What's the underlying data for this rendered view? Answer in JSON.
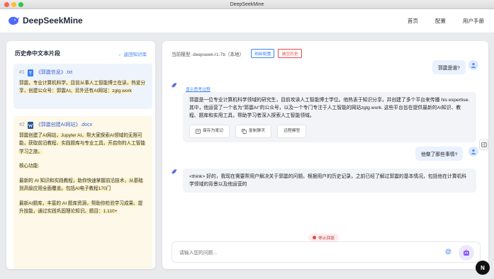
{
  "window": {
    "title": "DeepSeekMine"
  },
  "nav": {
    "brand": "DeepSeekMine",
    "links": [
      "首页",
      "配置",
      "用户手册"
    ]
  },
  "left": {
    "title": "历史命中文本片段",
    "back_label": "← 返回知识库",
    "fragments": [
      {
        "num": "#1",
        "name": "《郭震信息》.txt",
        "icon": "txt-file-icon",
        "paragraphs": [
          "郭震，专业计算机科学，目前从事人工智能博士在读，热爱分享，创建公众号：郭震AI。另外还有AI网站：zglg.work"
        ]
      },
      {
        "num": "#2",
        "name": "《郭震创建AI网站》.docx",
        "icon": "word-file-icon",
        "paragraphs": [
          "郭震创建了AI网站，Jupyter AI，帮大家探索AI领域的无限可能，获取前沿教程、实践题库与专业工具，开启你的人工智能学习之旅。",
          "核心功能:",
          "最新的 AI 知识和实践教程，助你快速掌握前沿技术，从基础到高级应用全面覆盖。包括AI电子教程170门",
          "最新AI题库，丰富的 AI 题库资源，帮助你检验学习成果、提升技能，通过实践巩固理论知识。题目：1,110+"
        ]
      }
    ]
  },
  "chat": {
    "model_label": "当前模型: deepseek-r1:7b（本地）",
    "refresh_label": "刷新配置",
    "clear_label": "清空历史",
    "messages": [
      {
        "role": "user",
        "text": "郭震是谁?"
      },
      {
        "role": "ai",
        "think_link": "显示思考过程",
        "text": "郭震是一位专业计算机科学领域的研究生，目前攻读人工智能博士学位。他热衷于知识分享，并创建了多个平台来传播 his expertise. 其中，他运营了一个名为\"郭震AI\"的公众号，以及一个专门专注于人工智能的网站zglg.work. 这些平台旨在提供最新的AI知识、教程、题库和实用工具，帮助学习者深入探索人工智能领域。",
        "actions": [
          "保存为笔记",
          "复制聊天",
          "远程模型"
        ]
      },
      {
        "role": "user",
        "text": "他做了那些事情?"
      },
      {
        "role": "ai",
        "text": "<think> 好的，我现在需要帮用户解决关于郭震的问题。根据用户的历史记录，之前已经了解过郭震的基本情况，包括他在计算机科学领域的背景以及他运营的"
      }
    ],
    "stop_label": "停止回复",
    "input_placeholder": "请输入您的问题..."
  },
  "overlay": {
    "badge": "N"
  },
  "colors": {
    "accent": "#3b82f6",
    "danger": "#ef4444",
    "user_bubble": "#eaf1ff",
    "ai_bubble": "#f2f4f7",
    "fragment1": "#eef4fc",
    "fragment2": "#fdf8e8"
  }
}
